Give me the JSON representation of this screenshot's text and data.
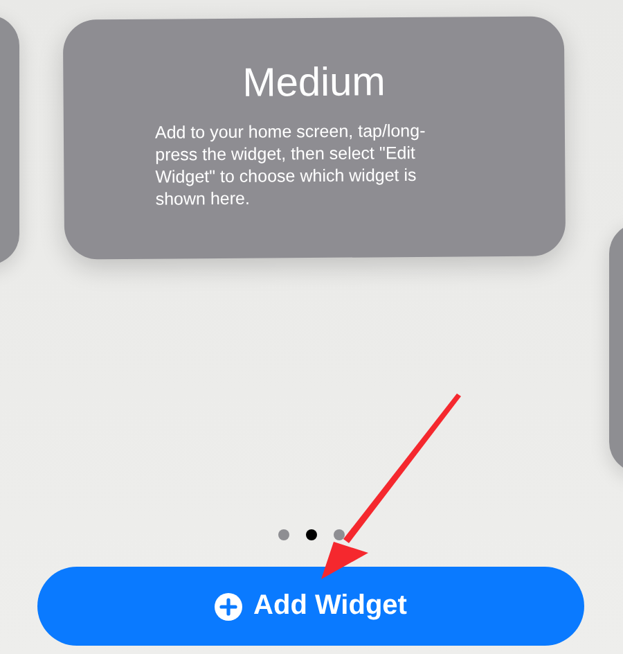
{
  "carousel": {
    "cards": [
      {
        "kind": "partial"
      },
      {
        "kind": "widget",
        "title": "Medium",
        "description": "Add to your home screen, tap/long-press the widget, then select \"Edit Widget\" to choose which widget is shown here."
      },
      {
        "kind": "partial"
      }
    ]
  },
  "page_dots": [
    {
      "selected": false
    },
    {
      "selected": true
    },
    {
      "selected": false
    }
  ],
  "add_button": {
    "label": "Add Widget"
  }
}
